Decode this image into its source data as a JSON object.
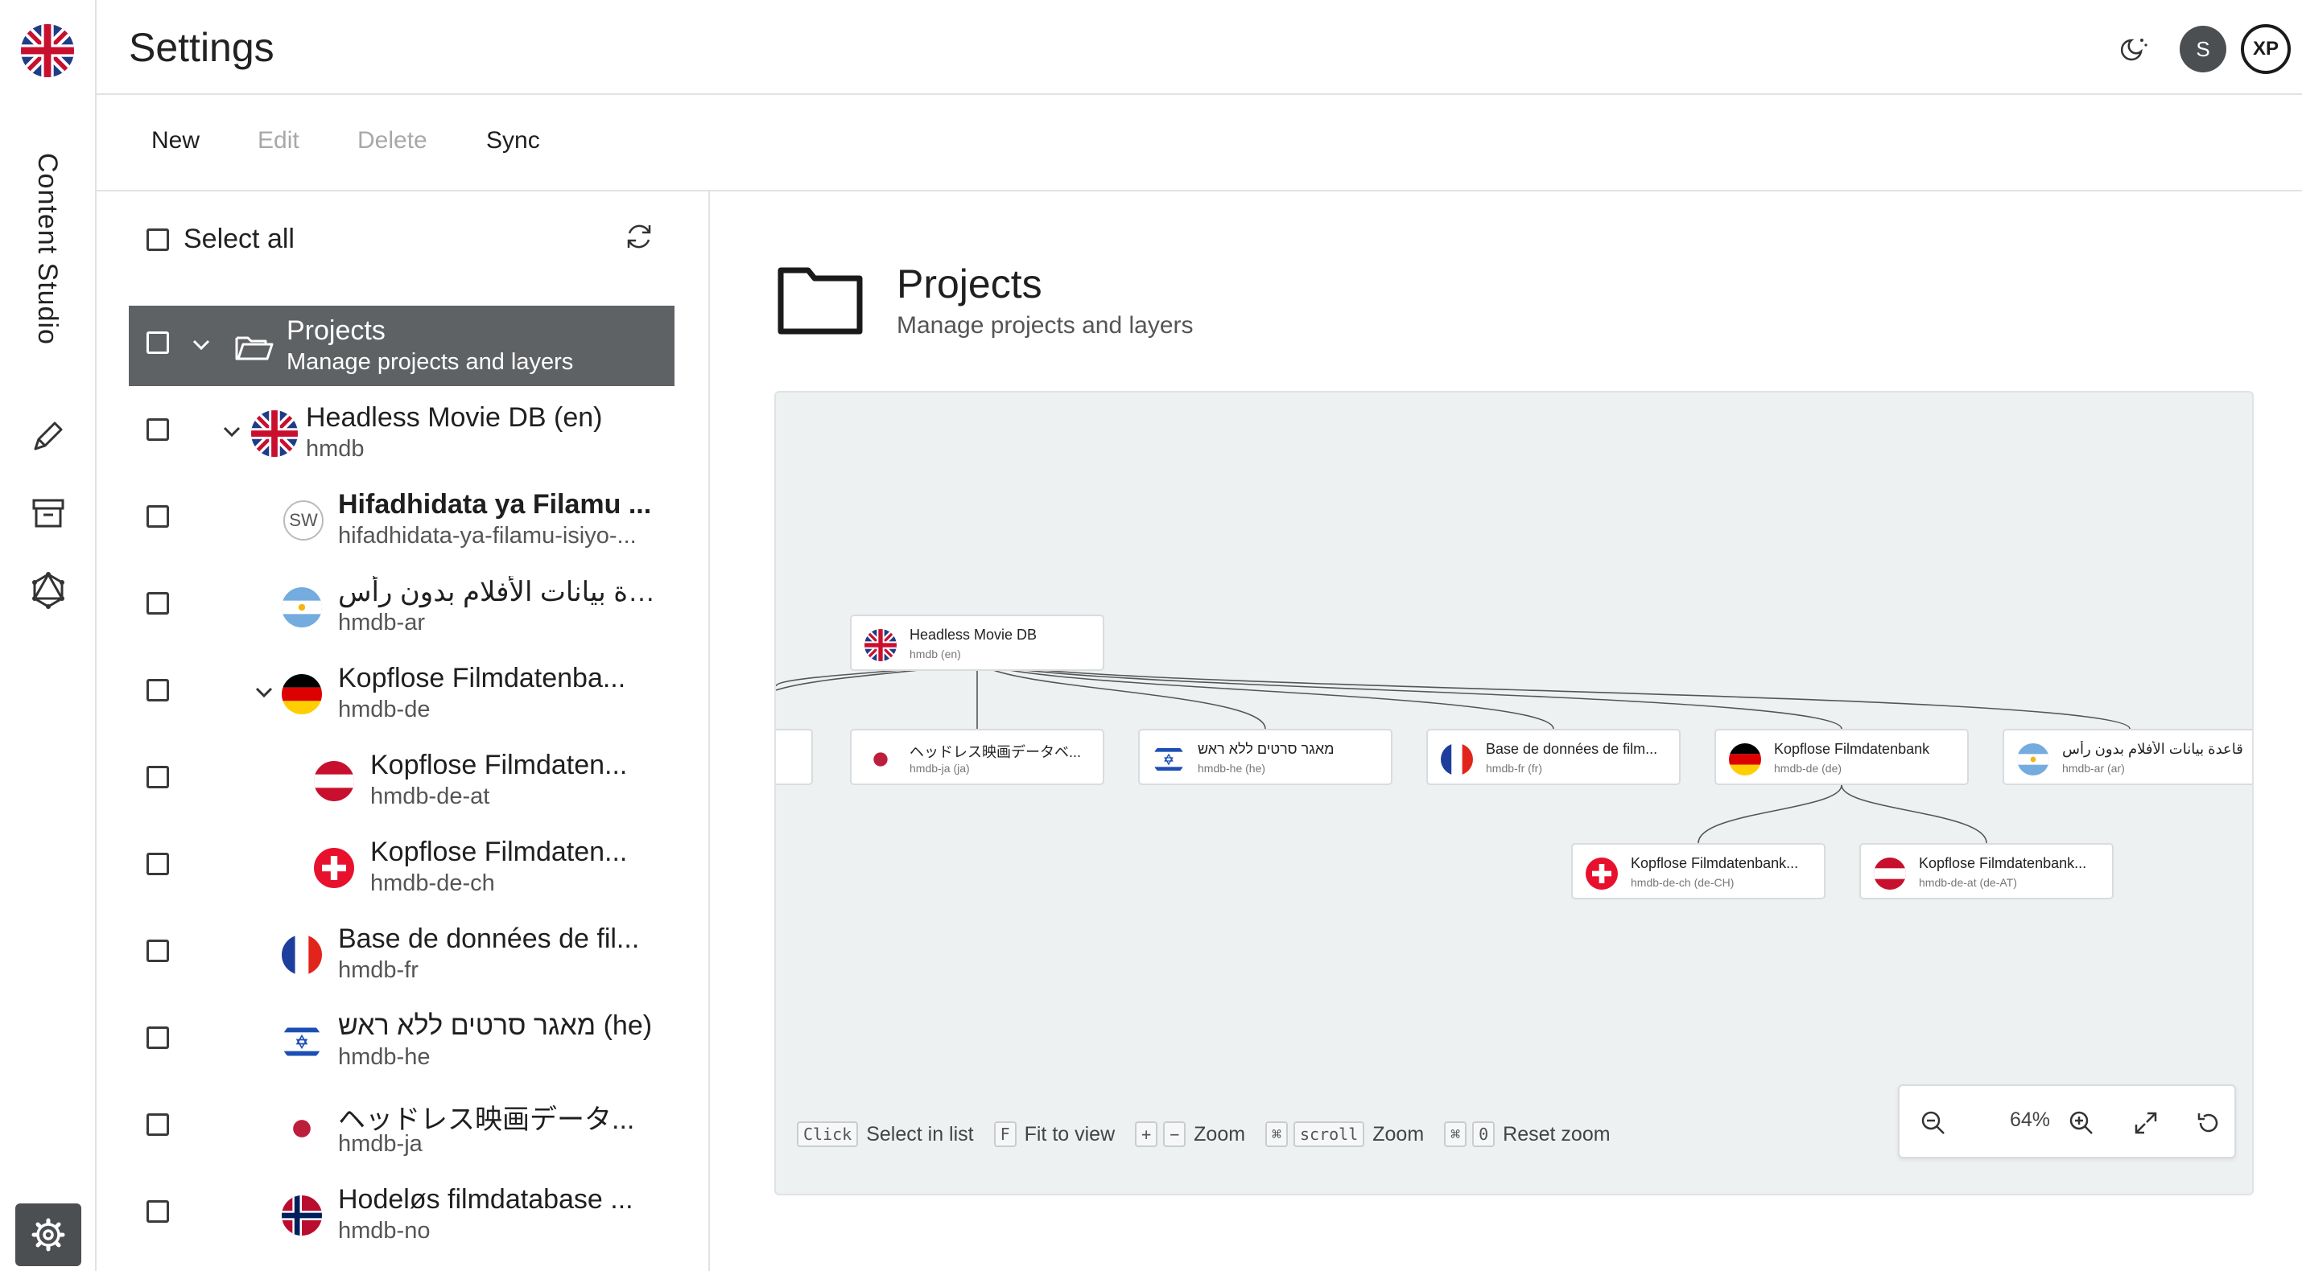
{
  "rail": {
    "app_name": "Content Studio",
    "icons": [
      "flag-uk-icon",
      "pencil-icon",
      "archive-icon",
      "graphql-icon",
      "gear-icon"
    ]
  },
  "header": {
    "title": "Settings",
    "avatar_initial": "S",
    "logo_text": "XP"
  },
  "toolbar": {
    "new_label": "New",
    "edit_label": "Edit",
    "delete_label": "Delete",
    "sync_label": "Sync"
  },
  "list": {
    "select_all_label": "Select all",
    "rows": [
      {
        "title": "Projects",
        "subtitle": "Manage projects and layers",
        "icon": "folder-open-icon"
      },
      {
        "title": "Headless Movie DB (en)",
        "subtitle": "hmdb",
        "icon": "flag-uk-icon"
      },
      {
        "title": "Hifadhidata ya Filamu ...",
        "subtitle": "hifadhidata-ya-filamu-isiyo-...",
        "icon": "sw-badge",
        "badge": "SW"
      },
      {
        "title": "قاعدة بيانات الأفلام بدون رأس (ar)",
        "subtitle": "hmdb-ar",
        "icon": "flag-ar-icon"
      },
      {
        "title": "Kopflose Filmdatenba...",
        "subtitle": "hmdb-de",
        "icon": "flag-de-icon"
      },
      {
        "title": "Kopflose Filmdaten...",
        "subtitle": "hmdb-de-at",
        "icon": "flag-at-icon"
      },
      {
        "title": "Kopflose Filmdaten...",
        "subtitle": "hmdb-de-ch",
        "icon": "flag-ch-icon"
      },
      {
        "title": "Base de données de fil...",
        "subtitle": "hmdb-fr",
        "icon": "flag-fr-icon"
      },
      {
        "title": "מאגר סרטים ללא ראש (he)",
        "subtitle": "hmdb-he",
        "icon": "flag-il-icon"
      },
      {
        "title": "ヘッドレス映画データ...",
        "subtitle": "hmdb-ja",
        "icon": "flag-jp-icon"
      },
      {
        "title": "Hodeløs filmdatabase ...",
        "subtitle": "hmdb-no",
        "icon": "flag-no-icon"
      }
    ]
  },
  "detail": {
    "title": "Projects",
    "subtitle": "Manage projects and layers"
  },
  "graph": {
    "root": {
      "title": "Headless Movie DB",
      "subtitle": "hmdb (en)"
    },
    "children": [
      {
        "title": "ヘッドレス映画データベ...",
        "subtitle": "hmdb-ja (ja)"
      },
      {
        "title": "מאגר סרטים ללא ראש",
        "subtitle": "hmdb-he (he)"
      },
      {
        "title": "Base de données de film...",
        "subtitle": "hmdb-fr (fr)"
      },
      {
        "title": "Kopflose Filmdatenbank",
        "subtitle": "hmdb-de (de)"
      },
      {
        "title": "قاعدة بيانات الأفلام بدون رأس",
        "subtitle": "hmdb-ar (ar)"
      }
    ],
    "grandchildren": [
      {
        "title": "Kopflose Filmdatenbank...",
        "subtitle": "hmdb-de-ch (de-CH)"
      },
      {
        "title": "Kopflose Filmdatenbank...",
        "subtitle": "hmdb-de-at (de-AT)"
      }
    ]
  },
  "hints": {
    "click_key": "Click",
    "click_text": "Select in list",
    "f_key": "F",
    "f_text": "Fit to view",
    "plus_key": "+",
    "minus_key": "−",
    "zoom_text": "Zoom",
    "cmd_key": "⌘",
    "scroll_key": "scroll",
    "scroll_text": "Zoom",
    "cmd2_key": "⌘",
    "zero_key": "0",
    "reset_text": "Reset zoom"
  },
  "zoom": {
    "level": "64%",
    "level_value": 0.64
  }
}
